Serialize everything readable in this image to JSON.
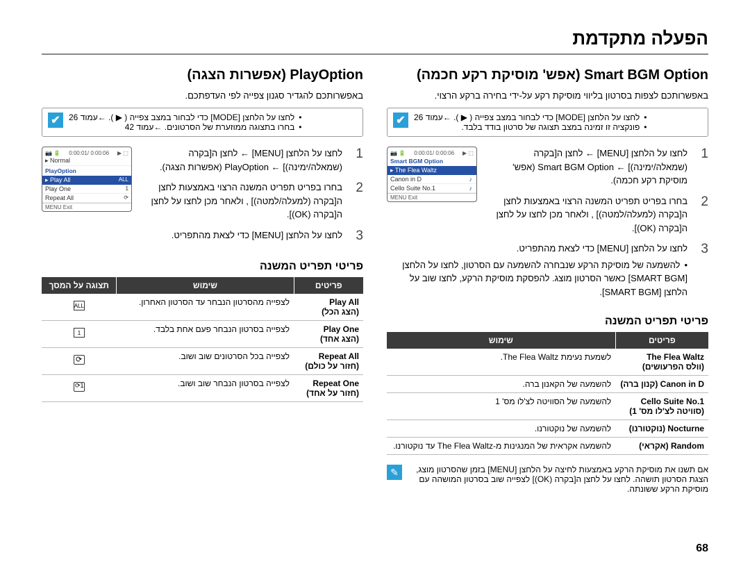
{
  "chapter": "הפעלה מתקדמת",
  "page_number": "68",
  "playoption": {
    "title_he": "(אפשרות הצגה)",
    "title_en": "PlayOption",
    "intro": "באפשרותכם להגדיר סגנון צפייה לפי העדפתכם.",
    "note_lines": [
      "לחצו על הלחצן [MODE] כדי לבחור במצב צפייה ( ▶ ). ←עמוד 26",
      "בחרו בתצוגה ממוזערת של הסרטונים. ←עמוד 42"
    ],
    "screenshot": {
      "time": "0:00:01/ 0:00:06",
      "normal": "Normal",
      "title": "PlayOption",
      "sel": "Play All",
      "opts": [
        "Play One",
        "Repeat All"
      ],
      "exit": "MENU  Exit"
    },
    "steps": {
      "s1": "לחצו על הלחצן [MENU] ← לחצן ה[בקרה (שמאלה/ימינה)] ← PlayOption (אפשרות הצגה).",
      "s2": "בחרו בפריט תפריט המשנה הרצוי באמצעות לחצן ה[בקרה (למעלה/למטה)] , ולאחר מכן לחצו על לחצן ה[בקרה (OK)].",
      "s3": "לחצו על הלחצן [MENU] כדי לצאת מהתפריט."
    },
    "table": {
      "headers": {
        "items": "פריטים",
        "use": "שימוש",
        "display": "תצוגה על המסך"
      },
      "rows": [
        {
          "item_en": "Play All",
          "item_he": "(הצג הכל)",
          "use": "לצפייה מהסרטון הנבחר עד הסרטון האחרון."
        },
        {
          "item_en": "Play One",
          "item_he": "(הצג אחד)",
          "use": "לצפייה בסרטון הנבחר פעם אחת בלבד."
        },
        {
          "item_en": "Repeat All",
          "item_he": "(חזור על כולם)",
          "use": "לצפייה בכל הסרטונים שוב ושוב."
        },
        {
          "item_en": "Repeat One",
          "item_he": "(חזור על אחד)",
          "use": "לצפייה בסרטון הנבחר שוב ושוב."
        }
      ]
    }
  },
  "smartbgm": {
    "title_he": "(אפש' מוסיקת רקע חכמה)",
    "title_en": "Smart BGM Option",
    "intro": "באפשרותכם לצפות בסרטון בליווי מוסיקת רקע על-ידי בחירה ברקע הרצוי.",
    "note_lines": [
      "לחצו על הלחצן [MODE] כדי לבחור במצב צפייה ( ▶ ). ←עמוד 26",
      "פונקציה זו זמינה במצב תצוגה של סרטון בודד בלבד."
    ],
    "screenshot": {
      "time": "0:00:01/ 0:00:06",
      "title": "Smart BGM Option",
      "sel": "The Flea Waltz",
      "opts": [
        "Canon in D",
        "Cello Suite No.1"
      ],
      "exit": "MENU  Exit"
    },
    "steps": {
      "s1": "לחצו על הלחצן [MENU] ← לחצן ה[בקרה (שמאלה/ימינה)] ← Smart BGM Option (אפש' מוסיקת רקע חכמה).",
      "s2": "בחרו בפריט תפריט המשנה הרצוי באמצעות לחצן ה[בקרה (למעלה/למטה)] , ולאחר מכן לחצו על לחצן ה[בקרה (OK)].",
      "s3_a": "לחצו על הלחצן [MENU] כדי לצאת מהתפריט.",
      "s3_b": "להשמעה של מוסיקת הרקע שנבחרה להשמעה עם הסרטון, לחצו על הלחצן [SMART BGM] כאשר הסרטון מוצג. להפסקת מוסיקת הרקע, לחצו שוב על הלחצן [SMART BGM]."
    },
    "table": {
      "headers": {
        "items": "פריטים",
        "use": "שימוש"
      },
      "rows": [
        {
          "item_en": "The Flea Waltz",
          "item_he": "(וולס הפרעושים)",
          "use": "לשמעת נעימת The Flea Waltz."
        },
        {
          "item_en": "Canon in D",
          "item_he": "(קנון ברה)",
          "use": "להשמעה של הקאנון ברה."
        },
        {
          "item_en": "Cello Suite No.1",
          "item_he": "(סוויטה לצ'לו מס' 1)",
          "use": "להשמעה של הסוויטה לצ'לו מס' 1"
        },
        {
          "item_en": "Nocturne",
          "item_he": "(נוקטורנו)",
          "use": "להשמעה של נוקטורנו."
        },
        {
          "item_en": "Random",
          "item_he": "(אקראי)",
          "use": "להשמעה אקראית של המנגינות מ-The Flea Waltz עד נוקטורנו."
        }
      ]
    },
    "pencil": "אם תשנו את מוסיקת הרקע באמצעות לחיצה על הלחצן [MENU] בזמן שהסרטון מוצג, הצגת הסרטון תושהה. לחצו על לחצן ה[בקרה (OK)] לצפייה שוב בסרטון המושהה עם מוסיקת הרקע ששונתה."
  },
  "submenu_label": "פריטי תפריט המשנה"
}
